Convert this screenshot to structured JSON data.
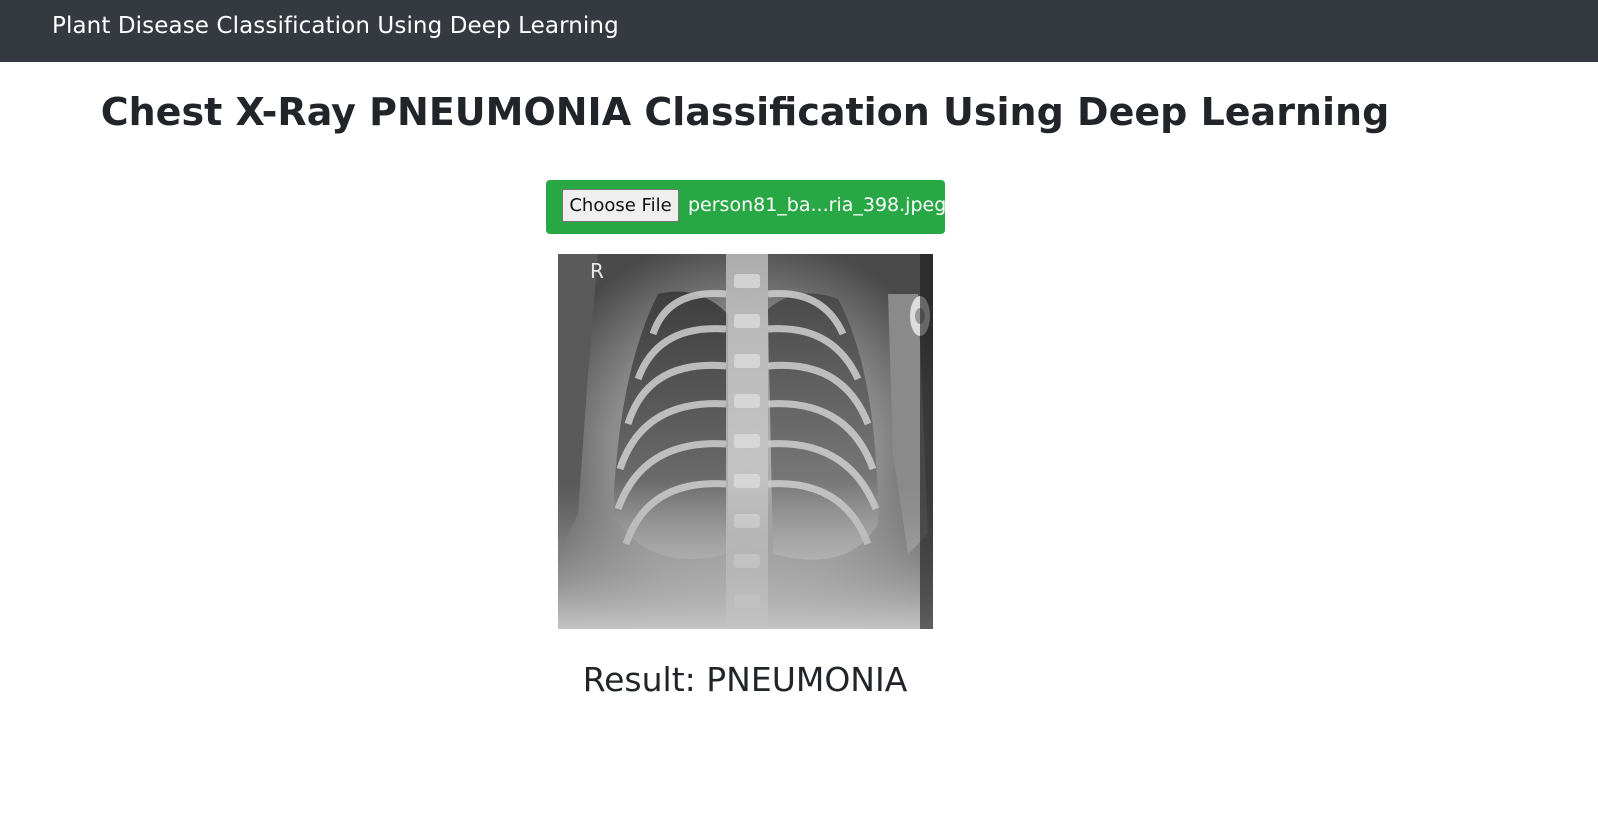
{
  "navbar": {
    "brand": "Plant Disease Classification Using Deep Learning"
  },
  "main": {
    "title": "Chest X-Ray PNEUMONIA Classification Using Deep Learning",
    "upload": {
      "button_label": "Choose File",
      "file_name": "person81_ba...ria_398.jpeg"
    },
    "preview": {
      "marker": "R"
    },
    "result": "Result: PNEUMONIA"
  },
  "colors": {
    "navbar_bg": "#343a40",
    "upload_bg": "#28a745",
    "text": "#212529"
  }
}
